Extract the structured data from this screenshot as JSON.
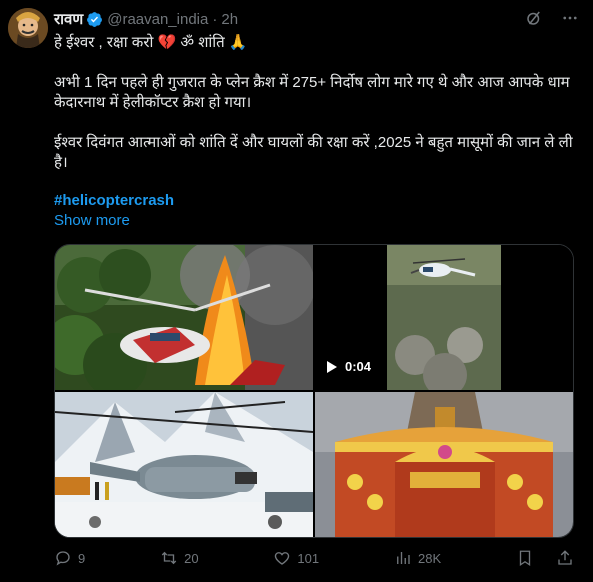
{
  "tweet": {
    "display_name": "रावण",
    "handle": "@raavan_india",
    "time": "2h",
    "line1": "हे ईश्वर , रक्षा करो 💔 ॐ शांति 🙏",
    "line2": "अभी 1 दिन पहले ही गुजरात के प्लेन क्रैश में 275+ निर्दोष लोग मारे गए थे और आज आपके धाम केदारनाथ में हेलीकॉप्टर क्रैश हो गया।",
    "line3": "ईश्वर दिवंगत आत्माओं को शांति दें और घायलों की रक्षा करें ,2025 ने बहुत मासूमों की जान ले ली है।",
    "hashtag": "#helicoptercrash",
    "show_more": "Show more"
  },
  "media": {
    "video_duration": "0:04"
  },
  "actions": {
    "replies": "9",
    "reposts": "20",
    "likes": "101",
    "views": "28K"
  },
  "colors": {
    "background": "#000000",
    "text": "#e7e9ea",
    "muted": "#71767b",
    "accent": "#1d9bf0"
  },
  "icons": [
    "verified-badge-icon",
    "grok-icon",
    "more-icon",
    "reply-icon",
    "repost-icon",
    "like-icon",
    "views-icon",
    "bookmark-icon",
    "share-icon",
    "play-icon"
  ]
}
